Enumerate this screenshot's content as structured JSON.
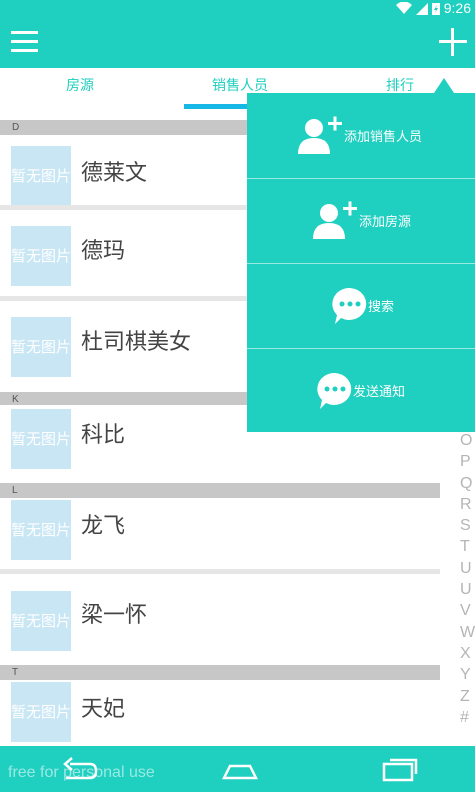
{
  "status_bar": {
    "time": "9:26"
  },
  "tabs": [
    {
      "label": "房源"
    },
    {
      "label": "销售人员"
    },
    {
      "label": "排行"
    }
  ],
  "list": {
    "placeholder_thumb": "暂无图片",
    "sections": [
      {
        "letter": "D",
        "items": [
          "德莱文",
          "德玛",
          "杜司棋美女"
        ]
      },
      {
        "letter": "K",
        "items": [
          "科比"
        ]
      },
      {
        "letter": "L",
        "items": [
          "龙飞",
          "梁一怀"
        ]
      },
      {
        "letter": "T",
        "items": [
          "天妃"
        ]
      }
    ]
  },
  "index_bar": [
    "O",
    "P",
    "Q",
    "R",
    "S",
    "T",
    "U",
    "U",
    "V",
    "W",
    "X",
    "Y",
    "Z",
    "#"
  ],
  "popup_menu": [
    {
      "label": "添加销售人员",
      "icon": "add-person-icon"
    },
    {
      "label": "添加房源",
      "icon": "add-person-icon"
    },
    {
      "label": "搜索",
      "icon": "chat-bubble-icon"
    },
    {
      "label": "发送通知",
      "icon": "chat-bubble-icon"
    }
  ],
  "nav_bar": {
    "watermark": "free for personal use"
  },
  "colors": {
    "accent": "#1fcfbf",
    "tab_indicator": "#18b8e6",
    "section_header": "#c7c7c7",
    "thumb_bg": "#c9e6f5"
  }
}
